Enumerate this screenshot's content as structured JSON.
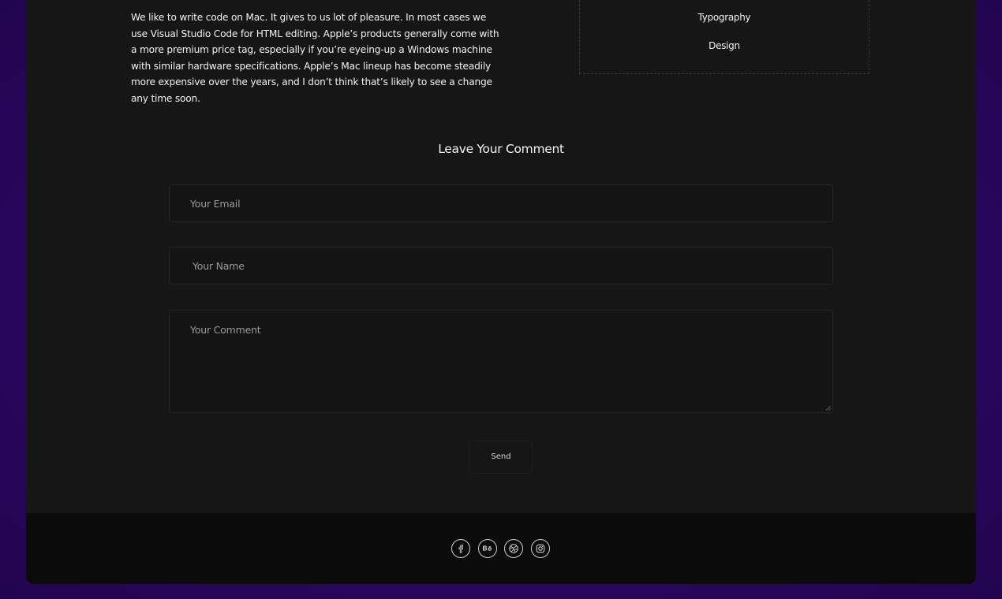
{
  "article": {
    "paragraph": "We like to write code on Mac. It gives to us lot of pleasure. In most cases we use Visual Studio Code for HTML editing. Apple’s products generally come with a more premium price tag, especially if you’re eyeing-up a Windows machine with similar hardware specifications. Apple’s Mac lineup has become steadily more expensive over the years, and I don’t think that’s likely to see a change any time soon."
  },
  "tags": [
    "Typography",
    "Design"
  ],
  "comment_form": {
    "title": "Leave Your Comment",
    "email_placeholder": "Your Email",
    "name_placeholder": "Your Name",
    "comment_placeholder": "Your Comment",
    "send_label": "Send"
  },
  "footer": {
    "social_icons": [
      "facebook-icon",
      "behance-icon",
      "dribbble-icon",
      "instagram-icon"
    ]
  },
  "colors": {
    "background": "#2a0660",
    "card": "#161616",
    "footer": "#0b0b0b",
    "text": "#f1f1f1"
  }
}
